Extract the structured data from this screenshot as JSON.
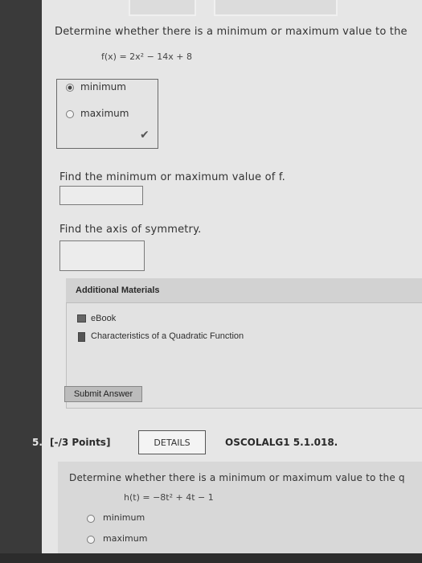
{
  "q4": {
    "prompt": "Determine whether there is a minimum or maximum value to the",
    "equation": "f(x) = 2x² − 14x + 8",
    "choices": [
      "minimum",
      "maximum"
    ],
    "selected_index": 0,
    "check_icon": "check-icon",
    "prompt_min_max": "Find the minimum or maximum value of f.",
    "prompt_axis": "Find the axis of symmetry.",
    "additional": {
      "title": "Additional Materials",
      "items": [
        {
          "icon": "ebook-icon",
          "label": "eBook"
        },
        {
          "icon": "document-icon",
          "label": "Characteristics of a Quadratic Function"
        }
      ]
    },
    "submit_label": "Submit Answer"
  },
  "q5": {
    "number": "5.",
    "points": "[-/3 Points]",
    "details_label": "DETAILS",
    "code": "OSCOLALG1 5.1.018.",
    "prompt": "Determine whether there is a minimum or maximum value to the q",
    "equation": "h(t) = −8t² + 4t − 1",
    "choices": [
      "minimum",
      "maximum"
    ]
  }
}
